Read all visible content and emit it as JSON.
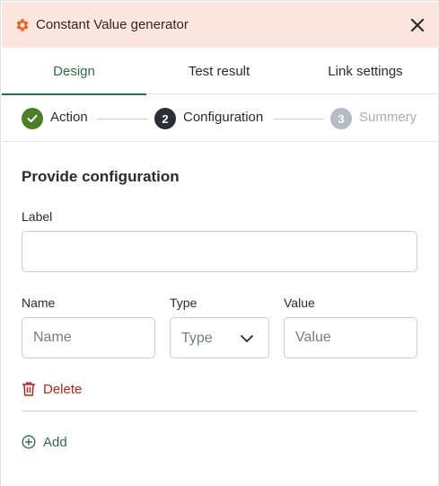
{
  "header": {
    "title": "Constant Value generator",
    "icon": "gear-icon",
    "close_icon": "close-icon",
    "background": "#fbe5dc",
    "icon_color": "#e0652a"
  },
  "tabs": [
    {
      "label": "Design",
      "active": true
    },
    {
      "label": "Test result",
      "active": false
    },
    {
      "label": "Link settings",
      "active": false
    }
  ],
  "stepper": {
    "steps": [
      {
        "number": "",
        "label": "Action",
        "state": "completed",
        "icon": "check-icon"
      },
      {
        "number": "2",
        "label": "Configuration",
        "state": "current"
      },
      {
        "number": "3",
        "label": "Summery",
        "state": "upcoming"
      }
    ]
  },
  "form": {
    "section_title": "Provide configuration",
    "label_field": {
      "label": "Label",
      "value": "",
      "placeholder": ""
    },
    "name_field": {
      "label": "Name",
      "value": "",
      "placeholder": "Name"
    },
    "type_field": {
      "label": "Type",
      "selected": "",
      "placeholder": "Type",
      "icon": "chevron-down-icon"
    },
    "value_field": {
      "label": "Value",
      "value": "",
      "placeholder": "Value"
    },
    "delete": {
      "label": "Delete",
      "icon": "trash-icon",
      "color": "#b3261e"
    },
    "add": {
      "label": "Add",
      "icon": "plus-circle-icon",
      "color": "#2f6b4a"
    }
  },
  "colors": {
    "accent": "#2f6b4a",
    "completed": "#4d7f2a",
    "current": "#2a2e36",
    "upcoming": "#b7bcc4"
  }
}
